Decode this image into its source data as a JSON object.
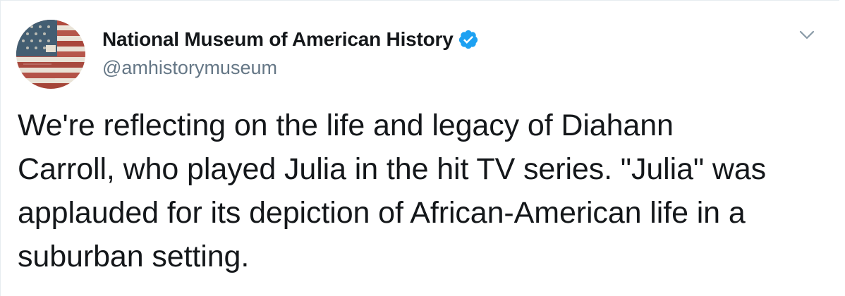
{
  "tweet": {
    "display_name": "National Museum of American History",
    "handle": "@amhistorymuseum",
    "verified": true,
    "verified_icon": "verified-badge-icon",
    "caret_icon": "chevron-down-icon",
    "avatar_icon": "american-flag-avatar",
    "text_lines": [
      "We're reflecting on the life and legacy of Diahann",
      "Carroll, who played Julia in the hit TV series. \"Julia\" was",
      "applauded for its depiction of African-American life in a",
      "suburban setting."
    ]
  },
  "colors": {
    "verified_blue": "#1da1f2",
    "handle_gray": "#657786",
    "text_dark": "#14171a",
    "caret_gray": "#8899a6"
  }
}
